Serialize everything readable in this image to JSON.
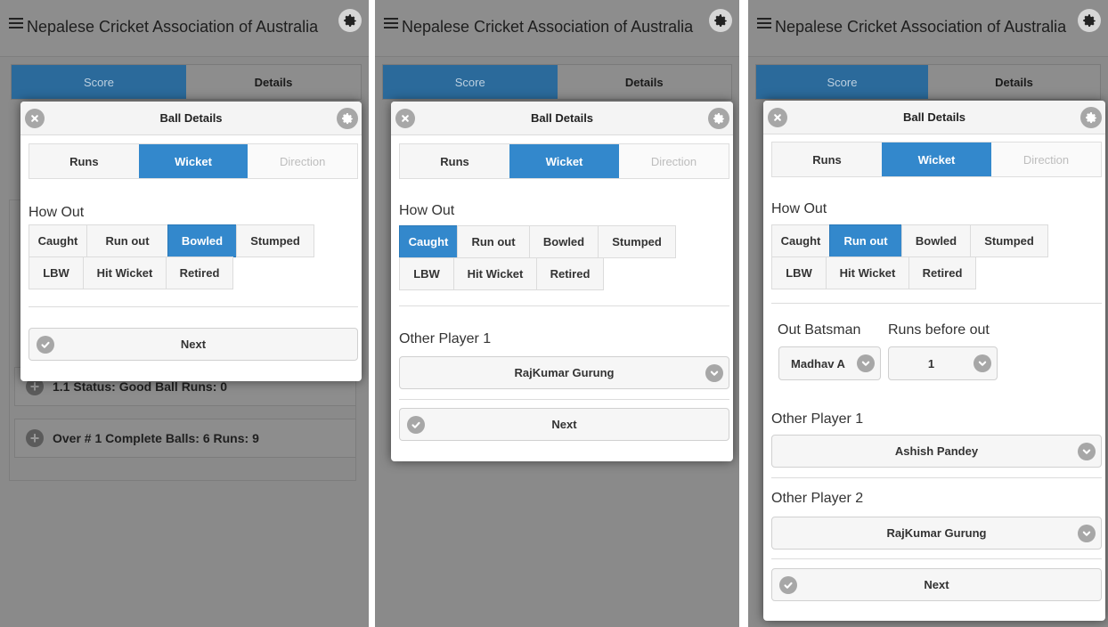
{
  "app_title": "Nepalese Cricket Association of Australia",
  "nav_tabs": [
    "Score",
    "Details"
  ],
  "dialog_title": "Ball Details",
  "ball_tabs": [
    "Runs",
    "Wicket",
    "Direction"
  ],
  "how_out_label": "How Out",
  "how_out_options": [
    "Caught",
    "Run out",
    "Bowled",
    "Stumped",
    "LBW",
    "Hit Wicket",
    "Retired"
  ],
  "next_label": "Next",
  "panels": [
    {
      "selected_how_out": "Bowled",
      "background_rows": [
        "1.1 Status: Good Ball Runs: 0",
        "Over # 1 Complete Balls: 6 Runs: 9"
      ]
    },
    {
      "selected_how_out": "Caught",
      "other_player_1_label": "Other Player 1",
      "other_player_1_value": "RajKumar Gurung"
    },
    {
      "selected_how_out": "Run out",
      "out_batsman_label": "Out Batsman",
      "out_batsman_value": "Madhav A",
      "runs_before_out_label": "Runs before out",
      "runs_before_out_value": "1",
      "other_player_1_label": "Other Player 1",
      "other_player_1_value": "Ashish Pandey",
      "other_player_2_label": "Other Player 2",
      "other_player_2_value": "RajKumar Gurung"
    }
  ],
  "colors": {
    "accent": "#3388cc",
    "overlay": "#8a8a8a",
    "nav_active": "#2b6a9b"
  }
}
